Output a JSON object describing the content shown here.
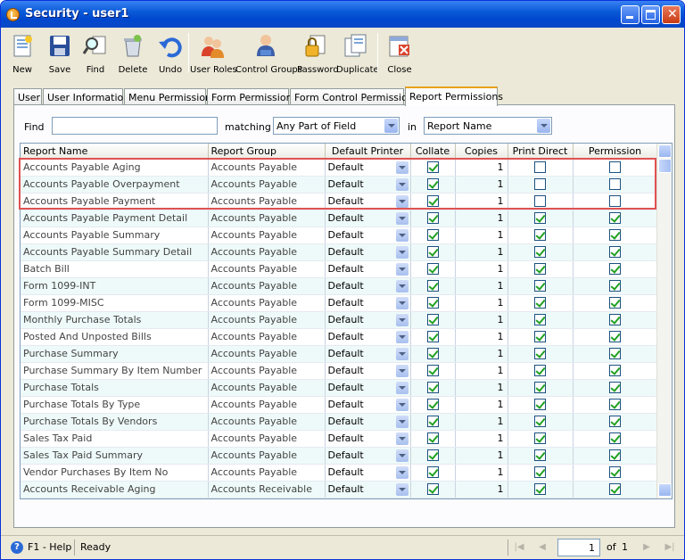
{
  "window": {
    "title": "Security - user1"
  },
  "toolbar": [
    {
      "label": "New",
      "icon": "new-icon"
    },
    {
      "label": "Save",
      "icon": "save-icon"
    },
    {
      "label": "Find",
      "icon": "find-icon"
    },
    {
      "label": "Delete",
      "icon": "delete-icon"
    },
    {
      "label": "Undo",
      "icon": "undo-icon"
    },
    {
      "label": "User Roles",
      "icon": "user-roles-icon"
    },
    {
      "label": "Control Groups",
      "icon": "control-groups-icon"
    },
    {
      "label": "Password",
      "icon": "password-icon"
    },
    {
      "label": "Duplicate",
      "icon": "duplicate-icon"
    },
    {
      "label": "Close",
      "icon": "close-form-icon"
    }
  ],
  "tabs": [
    "User",
    "User Information",
    "Menu Permissions",
    "Form Permissions",
    "Form Control Permissions",
    "Report Permissions"
  ],
  "active_tab": "Report Permissions",
  "filter": {
    "find_label": "Find",
    "find_value": "",
    "matching_label": "matching",
    "matching_value": "Any Part of Field",
    "in_label": "in",
    "in_value": "Report Name"
  },
  "grid": {
    "columns": [
      "Report Name",
      "Report Group",
      "Default Printer",
      "Collate",
      "Copies",
      "Print Direct",
      "Permission"
    ],
    "rows": [
      {
        "name": "Accounts Payable Aging",
        "group": "Accounts Payable",
        "printer": "Default",
        "collate": true,
        "copies": "1",
        "print_direct": false,
        "permission": false
      },
      {
        "name": "Accounts Payable Overpayment",
        "group": "Accounts Payable",
        "printer": "Default",
        "collate": true,
        "copies": "1",
        "print_direct": false,
        "permission": false
      },
      {
        "name": "Accounts Payable Payment",
        "group": "Accounts Payable",
        "printer": "Default",
        "collate": true,
        "copies": "1",
        "print_direct": false,
        "permission": false
      },
      {
        "name": "Accounts Payable Payment Detail",
        "group": "Accounts Payable",
        "printer": "Default",
        "collate": true,
        "copies": "1",
        "print_direct": true,
        "permission": true
      },
      {
        "name": "Accounts Payable Summary",
        "group": "Accounts Payable",
        "printer": "Default",
        "collate": true,
        "copies": "1",
        "print_direct": true,
        "permission": true
      },
      {
        "name": "Accounts Payable Summary Detail",
        "group": "Accounts Payable",
        "printer": "Default",
        "collate": true,
        "copies": "1",
        "print_direct": true,
        "permission": true
      },
      {
        "name": "Batch Bill",
        "group": "Accounts Payable",
        "printer": "Default",
        "collate": true,
        "copies": "1",
        "print_direct": true,
        "permission": true
      },
      {
        "name": "Form 1099-INT",
        "group": "Accounts Payable",
        "printer": "Default",
        "collate": true,
        "copies": "1",
        "print_direct": true,
        "permission": true
      },
      {
        "name": "Form 1099-MISC",
        "group": "Accounts Payable",
        "printer": "Default",
        "collate": true,
        "copies": "1",
        "print_direct": true,
        "permission": true
      },
      {
        "name": "Monthly Purchase Totals",
        "group": "Accounts Payable",
        "printer": "Default",
        "collate": true,
        "copies": "1",
        "print_direct": true,
        "permission": true
      },
      {
        "name": "Posted And Unposted Bills",
        "group": "Accounts Payable",
        "printer": "Default",
        "collate": true,
        "copies": "1",
        "print_direct": true,
        "permission": true
      },
      {
        "name": "Purchase Summary",
        "group": "Accounts Payable",
        "printer": "Default",
        "collate": true,
        "copies": "1",
        "print_direct": true,
        "permission": true
      },
      {
        "name": "Purchase Summary By Item Number",
        "group": "Accounts Payable",
        "printer": "Default",
        "collate": true,
        "copies": "1",
        "print_direct": true,
        "permission": true
      },
      {
        "name": "Purchase Totals",
        "group": "Accounts Payable",
        "printer": "Default",
        "collate": true,
        "copies": "1",
        "print_direct": true,
        "permission": true
      },
      {
        "name": "Purchase Totals By Type",
        "group": "Accounts Payable",
        "printer": "Default",
        "collate": true,
        "copies": "1",
        "print_direct": true,
        "permission": true
      },
      {
        "name": "Purchase Totals By Vendors",
        "group": "Accounts Payable",
        "printer": "Default",
        "collate": true,
        "copies": "1",
        "print_direct": true,
        "permission": true
      },
      {
        "name": "Sales Tax Paid",
        "group": "Accounts Payable",
        "printer": "Default",
        "collate": true,
        "copies": "1",
        "print_direct": true,
        "permission": true
      },
      {
        "name": "Sales Tax Paid Summary",
        "group": "Accounts Payable",
        "printer": "Default",
        "collate": true,
        "copies": "1",
        "print_direct": true,
        "permission": true
      },
      {
        "name": "Vendor Purchases By Item No",
        "group": "Accounts Payable",
        "printer": "Default",
        "collate": true,
        "copies": "1",
        "print_direct": true,
        "permission": true
      },
      {
        "name": "Accounts Receivable Aging",
        "group": "Accounts Receivable",
        "printer": "Default",
        "collate": true,
        "copies": "1",
        "print_direct": true,
        "permission": true
      }
    ]
  },
  "status": {
    "help": "F1 - Help",
    "state": "Ready",
    "page": "1",
    "of_label": "of",
    "total_pages": "1"
  }
}
